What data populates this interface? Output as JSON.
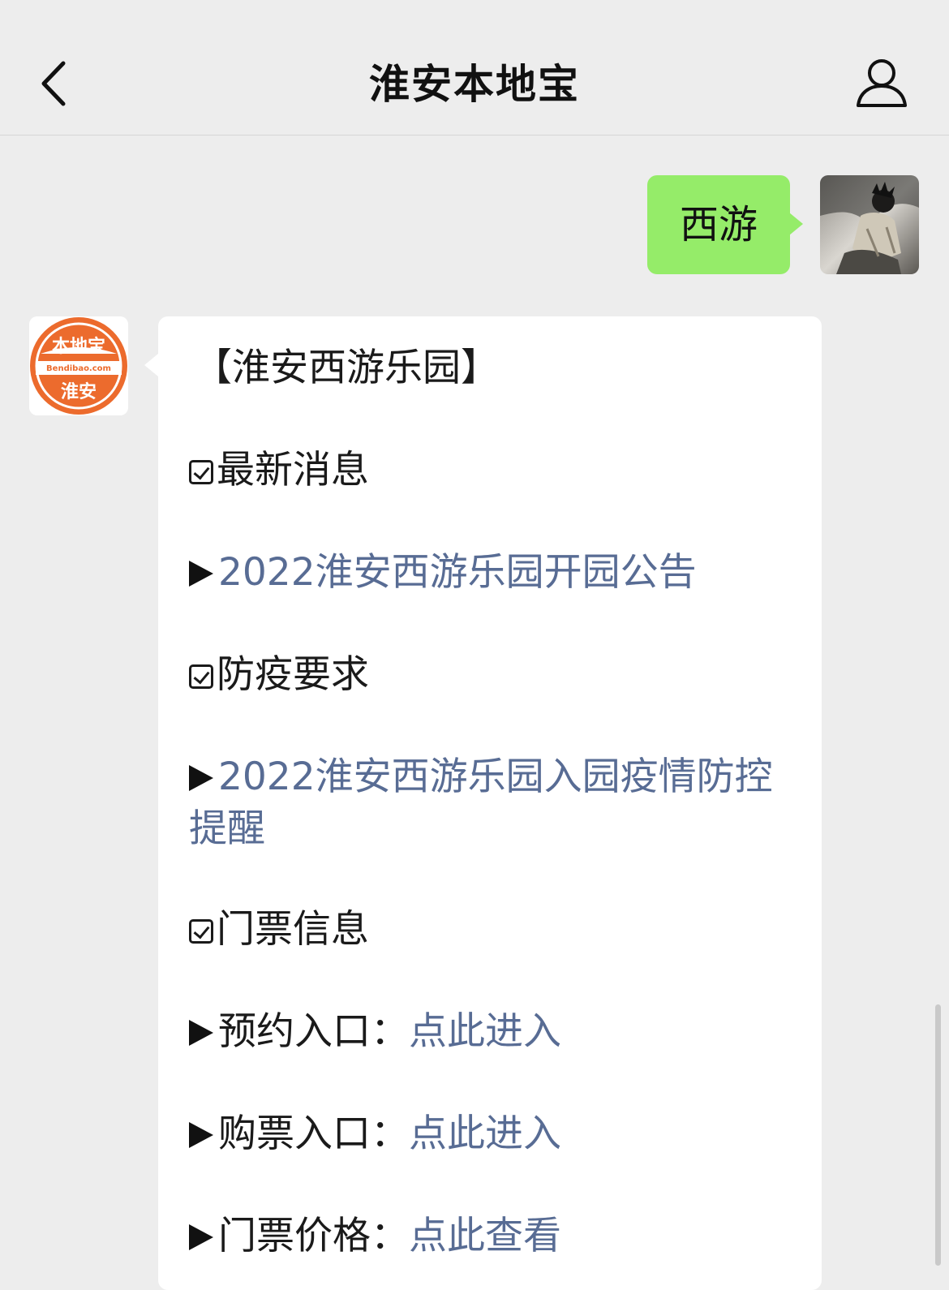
{
  "header": {
    "title": "淮安本地宝",
    "back_icon": "chevron-left-icon",
    "profile_icon": "person-icon"
  },
  "chat": {
    "outgoing": {
      "text": "西游",
      "bubble_color": "#95ec69"
    },
    "incoming": {
      "avatar": {
        "brand": "本地宝",
        "site": "Bendibao.com",
        "city": "淮安",
        "color": "#ec6b2d"
      },
      "title": "【淮安西游乐园】",
      "sections": [
        {
          "heading": "最新消息",
          "items": [
            {
              "label": "",
              "link": "2022淮安西游乐园开园公告"
            }
          ]
        },
        {
          "heading": "防疫要求",
          "items": [
            {
              "label": "",
              "link": "2022淮安西游乐园入园疫情防控提醒"
            }
          ]
        },
        {
          "heading": "门票信息",
          "items": [
            {
              "label": "预约入口：",
              "link": "点此进入"
            },
            {
              "label": "购票入口：",
              "link": "点此进入"
            },
            {
              "label": "门票价格：",
              "link": "点此查看"
            }
          ]
        }
      ],
      "link_color": "#586c94"
    }
  }
}
